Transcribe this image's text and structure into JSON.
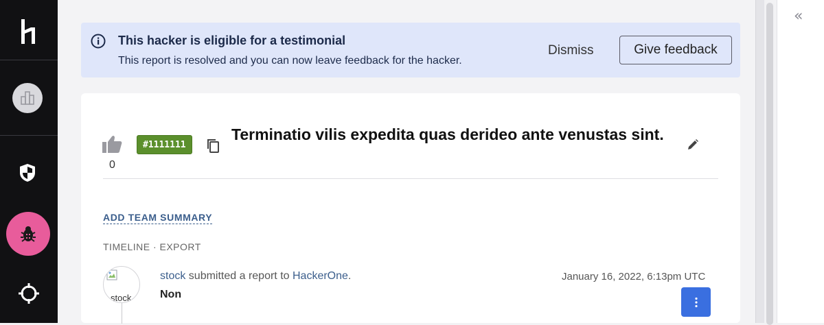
{
  "nav": {
    "logo_icon": "hackerone-logo",
    "items": [
      {
        "icon": "building-icon"
      },
      {
        "icon": "shield-icon"
      },
      {
        "icon": "bug-icon",
        "active": true,
        "active_color": "#e85c9b"
      },
      {
        "icon": "crosshair-icon"
      }
    ]
  },
  "banner": {
    "title": "This hacker is eligible for a testimonial",
    "text": "This report is resolved and you can now leave feedback for the hacker.",
    "dismiss_label": "Dismiss",
    "feedback_label": "Give feedback",
    "background": "#dfe6fa"
  },
  "report": {
    "vote_count": "0",
    "id_badge": "#1111111",
    "badge_color": "#5b8f2c",
    "title": "Terminatio vilis expedita quas derideo ante venustas sint."
  },
  "summary": {
    "add_team_summary": "ADD TEAM SUMMARY"
  },
  "timeline": {
    "header": "TIMELINE · EXPORT",
    "entry": {
      "avatar_alt": "stock",
      "user": "stock",
      "action": " submitted a report to ",
      "program": "HackerOne",
      "period": ".",
      "timestamp": "January 16, 2022, 6:13pm UTC",
      "body": "Non"
    },
    "actions_button_color": "#3a6fe0"
  },
  "sidebar": {
    "collapse_icon": "double-chevron-left-icon",
    "collapse_glyph": "«"
  }
}
